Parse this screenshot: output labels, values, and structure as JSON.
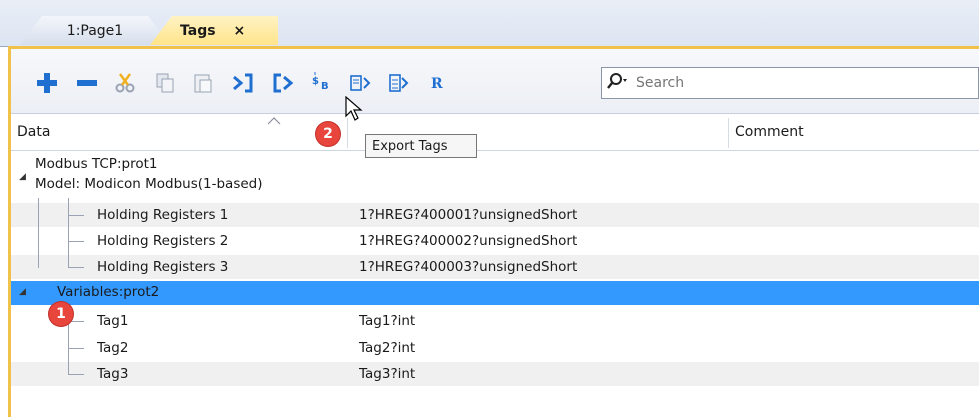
{
  "tabs": [
    {
      "label": "1:Page1"
    },
    {
      "label": "Tags",
      "close": "×"
    }
  ],
  "toolbar": {
    "buttons": [
      {
        "icon": "add-icon",
        "glyph": "+"
      },
      {
        "icon": "remove-icon",
        "glyph": "−"
      },
      {
        "icon": "cut-icon",
        "glyph": "✂"
      },
      {
        "icon": "copy-icon",
        "glyph": "❐"
      },
      {
        "icon": "paste-icon",
        "glyph": "▭"
      },
      {
        "icon": "import-tags-icon",
        "glyph": "›]"
      },
      {
        "icon": "export-tags-icon",
        "glyph": "[›"
      },
      {
        "icon": "convert-icon",
        "glyph": "⇅"
      },
      {
        "icon": "dictionary-icon",
        "glyph": "⊟"
      },
      {
        "icon": "dictionary-all-icon",
        "glyph": "⊞"
      },
      {
        "icon": "refactor-icon",
        "glyph": "R"
      }
    ],
    "colors": {
      "blue": "#1f6fd1",
      "gray": "#9aa3b3"
    },
    "search_placeholder": "Search"
  },
  "columns": {
    "data": "Data",
    "comment": "Comment"
  },
  "tooltip": "Export Tags",
  "badges": {
    "one": "1",
    "two": "2"
  },
  "tree": {
    "group1": {
      "line1": "Modbus TCP:prot1",
      "line2": "Model: Modicon Modbus(1-based)",
      "rows": [
        {
          "name": "Holding Registers 1",
          "value": "1?HREG?400001?unsignedShort"
        },
        {
          "name": "Holding Registers 2",
          "value": "1?HREG?400002?unsignedShort"
        },
        {
          "name": "Holding Registers 3",
          "value": "1?HREG?400003?unsignedShort"
        }
      ]
    },
    "group2": {
      "label": "Variables:prot2",
      "rows": [
        {
          "name": "Tag1",
          "value": "Tag1?int"
        },
        {
          "name": "Tag2",
          "value": "Tag2?int"
        },
        {
          "name": "Tag3",
          "value": "Tag3?int"
        }
      ]
    }
  },
  "selection_color": "#3399ff"
}
